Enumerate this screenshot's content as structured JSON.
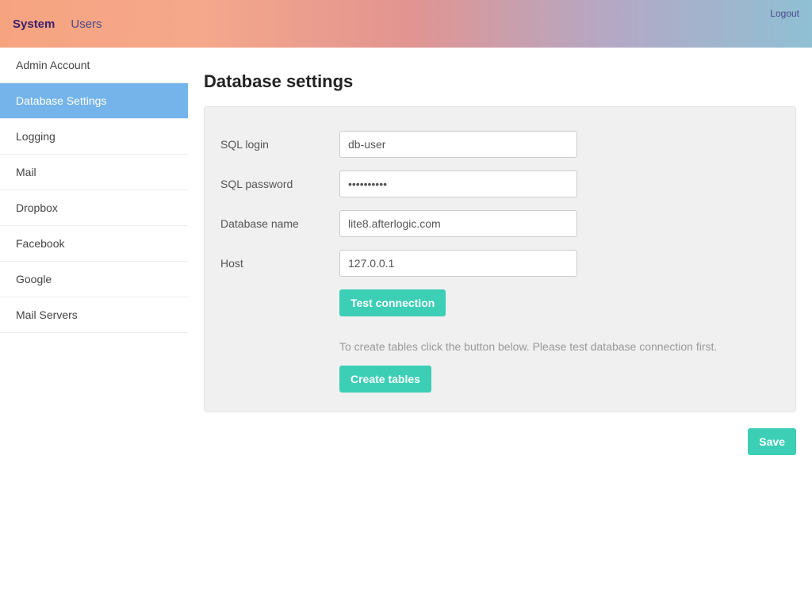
{
  "header": {
    "nav": [
      {
        "label": "System",
        "active": true
      },
      {
        "label": "Users",
        "active": false
      }
    ],
    "logout": "Logout"
  },
  "sidebar": {
    "items": [
      {
        "label": "Admin Account",
        "active": false
      },
      {
        "label": "Database Settings",
        "active": true
      },
      {
        "label": "Logging",
        "active": false
      },
      {
        "label": "Mail",
        "active": false
      },
      {
        "label": "Dropbox",
        "active": false
      },
      {
        "label": "Facebook",
        "active": false
      },
      {
        "label": "Google",
        "active": false
      },
      {
        "label": "Mail Servers",
        "active": false
      }
    ]
  },
  "main": {
    "title": "Database settings",
    "fields": {
      "sql_login": {
        "label": "SQL login",
        "value": "db-user"
      },
      "sql_password": {
        "label": "SQL password",
        "value": "••••••••••"
      },
      "db_name": {
        "label": "Database name",
        "value": "lite8.afterlogic.com"
      },
      "host": {
        "label": "Host",
        "value": "127.0.0.1"
      }
    },
    "test_connection_label": "Test connection",
    "help_text": "To create tables click the button below. Please test database connection first.",
    "create_tables_label": "Create tables",
    "save_label": "Save"
  }
}
